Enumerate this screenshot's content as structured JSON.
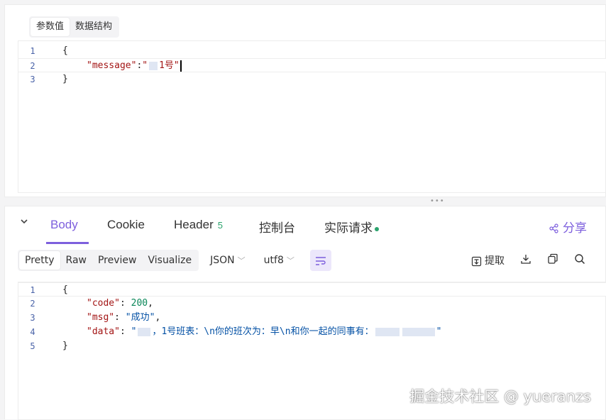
{
  "request": {
    "tabs": [
      {
        "label": "参数值",
        "active": true
      },
      {
        "label": "数据结构",
        "active": false
      }
    ],
    "code_lines": [
      {
        "number": "1",
        "text": "{"
      },
      {
        "number": "2",
        "key": "\"message\"",
        "colon": ":",
        "value_prefix": "\"",
        "value_suffix": "1号\""
      },
      {
        "number": "3",
        "text": "}"
      }
    ]
  },
  "response": {
    "collapse_icon": "chevron-down-icon",
    "tabs": [
      {
        "label": "Body",
        "active": true
      },
      {
        "label": "Cookie"
      },
      {
        "label": "Header",
        "badge": "5"
      },
      {
        "label": "控制台"
      },
      {
        "label": "实际请求",
        "status_dot": true
      }
    ],
    "share_label": "分享",
    "view_modes": [
      "Pretty",
      "Raw",
      "Preview",
      "Visualize"
    ],
    "active_view_mode": "Pretty",
    "format_select": "JSON",
    "encoding_select": "utf8",
    "extract_label": "提取",
    "code_lines": [
      {
        "number": "1",
        "text": "{"
      },
      {
        "number": "2",
        "key": "\"code\"",
        "value": "200",
        "suffix": ","
      },
      {
        "number": "3",
        "key": "\"msg\"",
        "value": "\"成功\"",
        "suffix": ","
      },
      {
        "number": "4",
        "key": "\"data\"",
        "value_prefix": "\"",
        "value_middle": "，1号班表：\\n你的班次为：早\\n和你一起的同事有：",
        "value_suffix": "\""
      },
      {
        "number": "5",
        "text": "}"
      }
    ]
  },
  "watermark": "掘金技术社区 @ yueranzs",
  "colors": {
    "accent": "#7d5fdd",
    "success": "#2ba36d"
  }
}
